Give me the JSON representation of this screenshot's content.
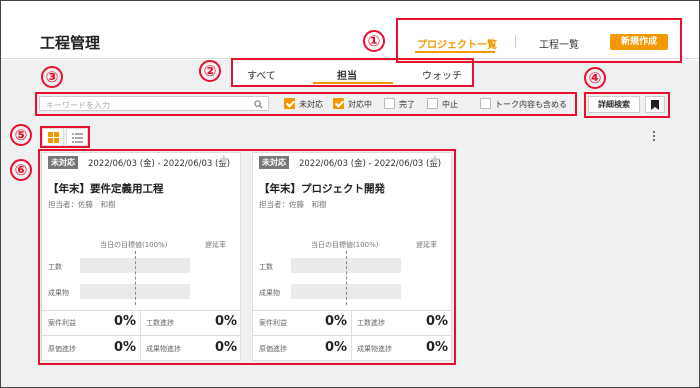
{
  "header": {
    "title": "工程管理",
    "project_list": "プロジェクト一覧",
    "process_list": "工程一覧",
    "new_button": "新規作成"
  },
  "tabs": [
    "すべて",
    "担当",
    "ウォッチ"
  ],
  "search": {
    "placeholder": "キーワードを入力",
    "filters": [
      {
        "label": "未対応",
        "checked": true
      },
      {
        "label": "対応中",
        "checked": true
      },
      {
        "label": "完了",
        "checked": false
      },
      {
        "label": "中止",
        "checked": false
      },
      {
        "label": "トーク内容も含める",
        "checked": false
      }
    ],
    "advanced_button": "詳細検索"
  },
  "callouts": [
    "①",
    "②",
    "③",
    "④",
    "⑤",
    "⑥"
  ],
  "cards": [
    {
      "status": "未対応",
      "date": "2022/06/03 (金) - 2022/06/03 (金)",
      "title": "【年末】要件定義用工程",
      "owner": "担当者：佐藤　和樹",
      "target_label": "当日の目標値(100%)",
      "delay_label": "遅延率",
      "row1": "工数",
      "row2": "成果物",
      "stat1_label": "案件利益",
      "stat1_value": "0%",
      "stat2_label": "工数進捗",
      "stat2_value": "0%",
      "stat3_label": "原価進捗",
      "stat3_value": "0%",
      "stat4_label": "成果物進捗",
      "stat4_value": "0%"
    },
    {
      "status": "未対応",
      "date": "2022/06/03 (金) - 2022/06/03 (金)",
      "title": "【年末】プロジェクト開発",
      "owner": "担当者：佐藤　和樹",
      "target_label": "当日の目標値(100%)",
      "delay_label": "遅延率",
      "row1": "工数",
      "row2": "成果物",
      "stat1_label": "案件利益",
      "stat1_value": "0%",
      "stat2_label": "工数進捗",
      "stat2_value": "0%",
      "stat3_label": "原価進捗",
      "stat3_value": "0%",
      "stat4_label": "成果物進捗",
      "stat4_value": "0%"
    }
  ],
  "colors": {
    "accent": "#f39800",
    "callout": "#e8112d"
  }
}
